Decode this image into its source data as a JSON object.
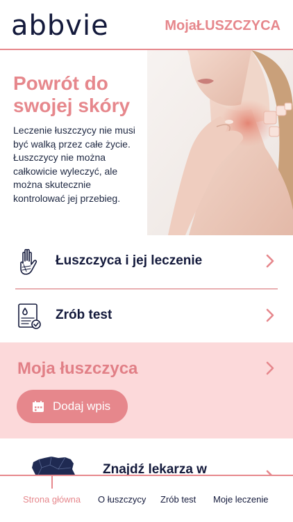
{
  "header": {
    "logo_text": "abbvie",
    "brand_title": "MojaŁUSZCZYCA"
  },
  "hero": {
    "title": "Powrót do swojej skóry",
    "text": "Leczenie łuszczycy nie musi być walką przez całe życie. Łuszczycy nie można całkowicie wyleczyć, ale można skutecznie kontrolować jej przebieg."
  },
  "menu": {
    "items": [
      {
        "label": "Łuszczyca i jej leczenie",
        "icon": "hand-icon"
      },
      {
        "label": "Zrób test",
        "icon": "test-form-icon"
      }
    ]
  },
  "journal": {
    "title": "Moja łuszczyca",
    "add_label": "Dodaj wpis",
    "add_icon": "calendar-icon"
  },
  "doctor": {
    "label": "Znajdź lekarza w",
    "icon": "poland-map-icon"
  },
  "tabbar": {
    "tabs": [
      {
        "label": "Strona główna",
        "active": true
      },
      {
        "label": "O łuszczycy",
        "active": false
      },
      {
        "label": "Zrób test",
        "active": false
      },
      {
        "label": "Moje leczenie",
        "active": false
      }
    ]
  },
  "colors": {
    "accent": "#e6878c",
    "navy": "#13193b",
    "pink_bg": "#fcd9da"
  }
}
